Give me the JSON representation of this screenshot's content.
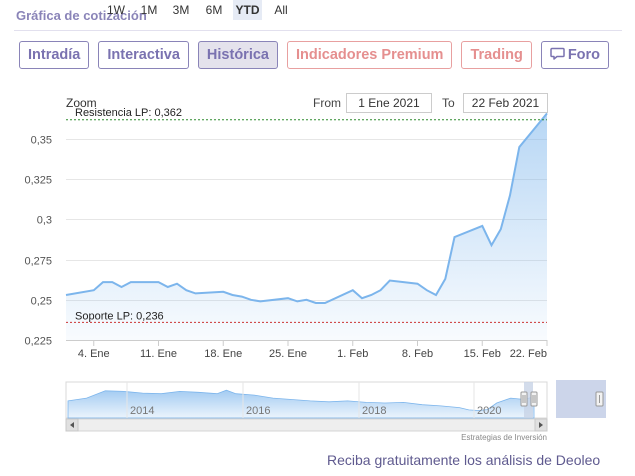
{
  "section_title": "Gráfica de cotización",
  "tabs": [
    {
      "label": "Intradía",
      "active": false,
      "style": "normal"
    },
    {
      "label": "Interactiva",
      "active": false,
      "style": "normal"
    },
    {
      "label": "Histórica",
      "active": true,
      "style": "normal"
    },
    {
      "label": "Indicadores Premium",
      "active": false,
      "style": "premium"
    },
    {
      "label": "Trading",
      "active": false,
      "style": "premium"
    },
    {
      "label": "Foro",
      "active": false,
      "style": "normal",
      "icon": "chat-bubble-icon"
    }
  ],
  "toolbar": {
    "zoom_label": "Zoom",
    "zoom_options": [
      "1W",
      "1M",
      "3M",
      "6M",
      "YTD",
      "All"
    ],
    "zoom_selected": "YTD",
    "from_label": "From",
    "from_value": "1 Ene 2021",
    "to_label": "To",
    "to_value": "22 Feb 2021"
  },
  "colors": {
    "accent": "#7a72b0",
    "premium": "#e58f8f",
    "series_line": "#7cb5ec",
    "resistance": "#2e8b2e",
    "support": "#cc3333"
  },
  "chart_data": {
    "type": "area",
    "x_ticks": [
      "4. Ene",
      "11. Ene",
      "18. Ene",
      "25. Ene",
      "1. Feb",
      "8. Feb",
      "15. Feb",
      "22. Feb"
    ],
    "y_ticks": [
      "0,35",
      "0,325",
      "0,3",
      "0,275",
      "0,25",
      "0,225"
    ],
    "ylim": [
      0.225,
      0.36
    ],
    "x": [
      "2021-01-01",
      "2021-01-04",
      "2021-01-05",
      "2021-01-06",
      "2021-01-07",
      "2021-01-08",
      "2021-01-11",
      "2021-01-12",
      "2021-01-13",
      "2021-01-14",
      "2021-01-15",
      "2021-01-18",
      "2021-01-19",
      "2021-01-20",
      "2021-01-21",
      "2021-01-22",
      "2021-01-25",
      "2021-01-26",
      "2021-01-27",
      "2021-01-28",
      "2021-01-29",
      "2021-02-01",
      "2021-02-02",
      "2021-02-03",
      "2021-02-04",
      "2021-02-05",
      "2021-02-08",
      "2021-02-09",
      "2021-02-10",
      "2021-02-11",
      "2021-02-12",
      "2021-02-15",
      "2021-02-16",
      "2021-02-17",
      "2021-02-18",
      "2021-02-19",
      "2021-02-22"
    ],
    "series": [
      {
        "values": [
          0.253,
          0.256,
          0.261,
          0.261,
          0.258,
          0.261,
          0.261,
          0.258,
          0.26,
          0.256,
          0.254,
          0.255,
          0.253,
          0.252,
          0.25,
          0.249,
          0.251,
          0.249,
          0.25,
          0.248,
          0.248,
          0.256,
          0.251,
          0.253,
          0.256,
          0.262,
          0.26,
          0.256,
          0.253,
          0.263,
          0.289,
          0.296,
          0.284,
          0.294,
          0.315,
          0.345,
          0.366
        ]
      }
    ],
    "annotations": [
      {
        "label": "Resistencia LP: 0,362",
        "value": 0.362,
        "kind": "resistance"
      },
      {
        "label": "Soporte LP: 0,236",
        "value": 0.236,
        "kind": "support"
      }
    ],
    "navigator": {
      "x_labels": [
        "2014",
        "2016",
        "2018",
        "2020"
      ],
      "credit": "Estrategias de Inversión"
    },
    "grid": "horizontal",
    "legend": "none"
  },
  "footer_link": "Reciba gratuitamente los análisis de Deoleo"
}
